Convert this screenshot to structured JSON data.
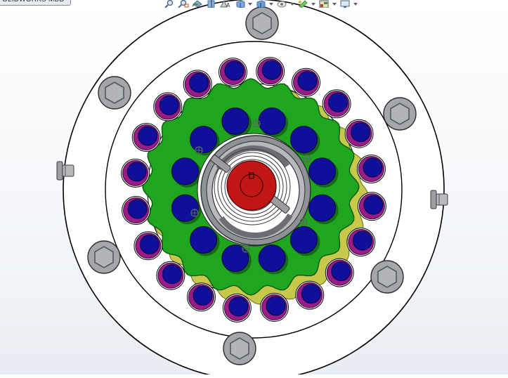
{
  "document_tab": {
    "label": "OLIDWORKS MBD"
  },
  "toolbar": {
    "items": [
      {
        "icon": "zoom-to-fit-icon",
        "color": "#4a6b8a"
      },
      {
        "icon": "zoom-to-area-icon",
        "color": "#4a6b8a"
      },
      {
        "icon": "previous-view-icon",
        "color": "#4a6b8a"
      },
      {
        "icon": "section-view-icon",
        "color": "#3c6fb0"
      },
      {
        "icon": "dynamic-annotation-icon",
        "color": "#6b6b6b"
      },
      {
        "icon": "view-orientation-icon",
        "color": "#3c6fb0",
        "dropdown": true
      },
      {
        "icon": "display-style-icon",
        "color": "#3c6fb0",
        "dropdown": true
      },
      {
        "icon": "hide-show-items-icon",
        "color": "#7a7a7a",
        "dropdown": true
      },
      {
        "icon": "edit-appearance-icon",
        "color": "#3a9a3a",
        "dropdown": true
      },
      {
        "icon": "apply-scene-icon",
        "color": "#b04a2a",
        "dropdown": true
      },
      {
        "icon": "view-settings-icon",
        "color": "#4a6b8a",
        "dropdown": true
      }
    ]
  },
  "colors": {
    "plate_fill": "#ffffff",
    "outline": "#000000",
    "bolt_gray": "#a4a6a9",
    "bolt_dark": "#55585c",
    "gear_green": "#1fa51f",
    "gear_edge": "#0d5a0d",
    "roller_blue": "#0f0f9a",
    "roller_magenta": "#9a1a8a",
    "yellow": "#c8c84a",
    "shaft_red": "#c01616",
    "bearing_gray": "#8e9196"
  }
}
